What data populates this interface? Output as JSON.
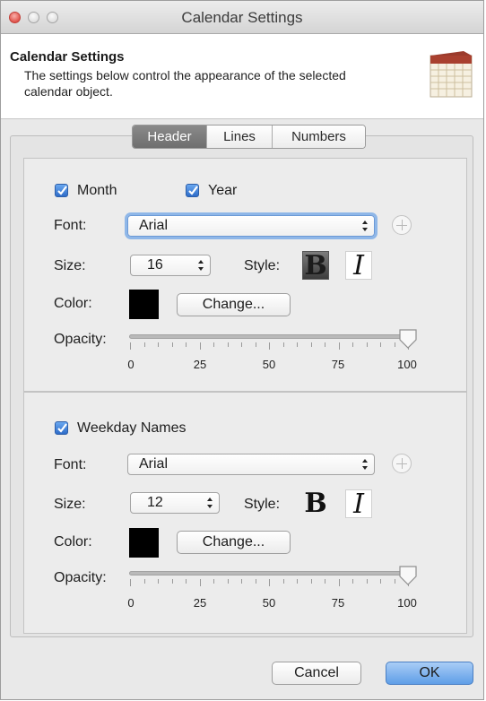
{
  "window": {
    "title": "Calendar Settings"
  },
  "header": {
    "title": "Calendar Settings",
    "description": "The settings below control the appearance of the selected calendar object.",
    "icon": "calendar-icon"
  },
  "tabs": [
    {
      "label": "Header",
      "active": true
    },
    {
      "label": "Lines",
      "active": false
    },
    {
      "label": "Numbers",
      "active": false
    }
  ],
  "header_section": {
    "month_label": "Month",
    "month_checked": true,
    "year_label": "Year",
    "year_checked": true,
    "font_label": "Font:",
    "font_value": "Arial",
    "size_label": "Size:",
    "size_value": "16",
    "style_label": "Style:",
    "bold_glyph": "B",
    "italic_glyph": "I",
    "bold_active": true,
    "color_label": "Color:",
    "color_value": "#000000",
    "change_label": "Change...",
    "opacity_label": "Opacity:",
    "opacity_value": 100,
    "opacity_ticks": [
      "0",
      "25",
      "50",
      "75",
      "100"
    ]
  },
  "weekday_section": {
    "weekday_label": "Weekday Names",
    "weekday_checked": true,
    "font_label": "Font:",
    "font_value": "Arial",
    "size_label": "Size:",
    "size_value": "12",
    "style_label": "Style:",
    "bold_glyph": "B",
    "italic_glyph": "I",
    "bold_active": false,
    "color_label": "Color:",
    "color_value": "#000000",
    "change_label": "Change...",
    "opacity_label": "Opacity:",
    "opacity_value": 100,
    "opacity_ticks": [
      "0",
      "25",
      "50",
      "75",
      "100"
    ]
  },
  "footer": {
    "cancel_label": "Cancel",
    "ok_label": "OK"
  },
  "colors": {
    "accent": "#5f9ee7",
    "checkbox": "#2e6cc8",
    "focus_ring": "#8fb7e8"
  }
}
